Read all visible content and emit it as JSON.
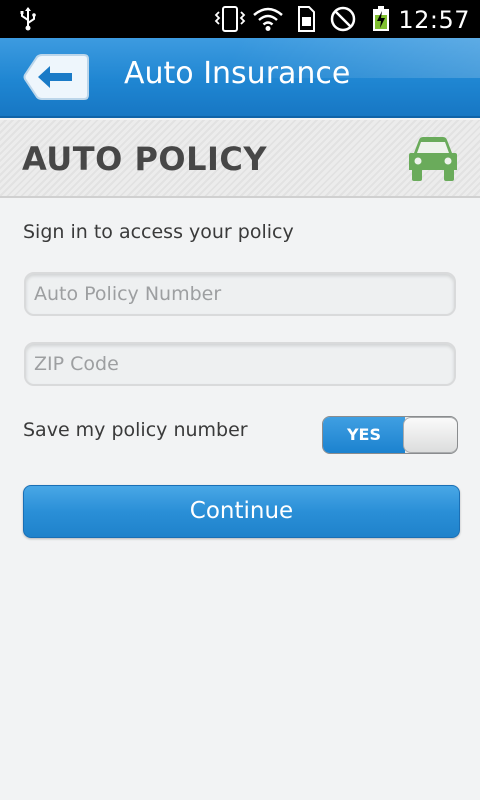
{
  "status_bar": {
    "time": "12:57",
    "icons": [
      "usb-icon",
      "vibrate-icon",
      "wifi-icon",
      "sim-icon",
      "no-signal-icon",
      "battery-charging-icon"
    ]
  },
  "app_bar": {
    "title": "Auto Insurance",
    "back_icon": "back-arrow-icon"
  },
  "section": {
    "title": "AUTO POLICY",
    "icon": "car-icon",
    "icon_color": "#6aab5b"
  },
  "form": {
    "subtitle": "Sign in to access your policy",
    "policy_number": {
      "value": "",
      "placeholder": "Auto Policy Number"
    },
    "zip_code": {
      "value": "",
      "placeholder": "ZIP Code"
    },
    "save_label": "Save my policy number",
    "save_toggle": {
      "state": "on",
      "label": "YES"
    },
    "continue_label": "Continue"
  },
  "colors": {
    "accent": "#1f86d2",
    "background": "#f2f3f4"
  }
}
